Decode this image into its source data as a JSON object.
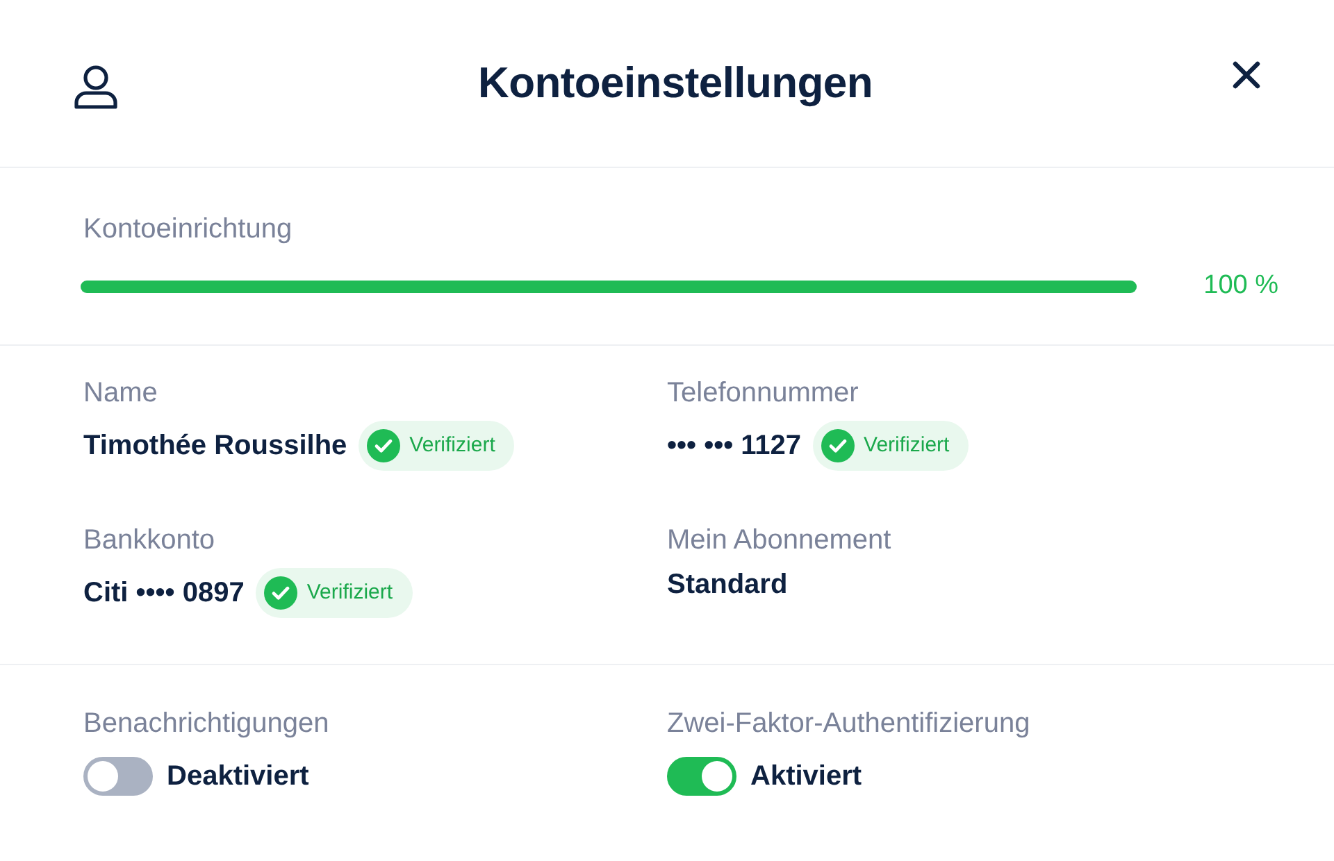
{
  "header": {
    "title": "Kontoeinstellungen"
  },
  "setup": {
    "label": "Kontoeinrichtung",
    "level": 1.0,
    "reading": "100 %"
  },
  "fields": [
    {
      "label": "Name",
      "value": "Timothée Roussilhe",
      "verified": true,
      "badge": "Verifiziert"
    },
    {
      "label": "Telefonnummer",
      "value": "••• ••• 1127",
      "verified": true,
      "badge": "Verifiziert"
    },
    {
      "label": "Bankkonto",
      "value": "Citi •••• 0897",
      "verified": true,
      "badge": "Verifiziert"
    },
    {
      "label": "Mein Abonnement",
      "value": "Standard",
      "verified": false
    }
  ],
  "settings": [
    {
      "label": "Benachrichtigungen",
      "on": false,
      "state": "Deaktiviert"
    },
    {
      "label": "Zwei-Faktor-Authentifizierung",
      "on": true,
      "state": "Aktiviert"
    }
  ]
}
